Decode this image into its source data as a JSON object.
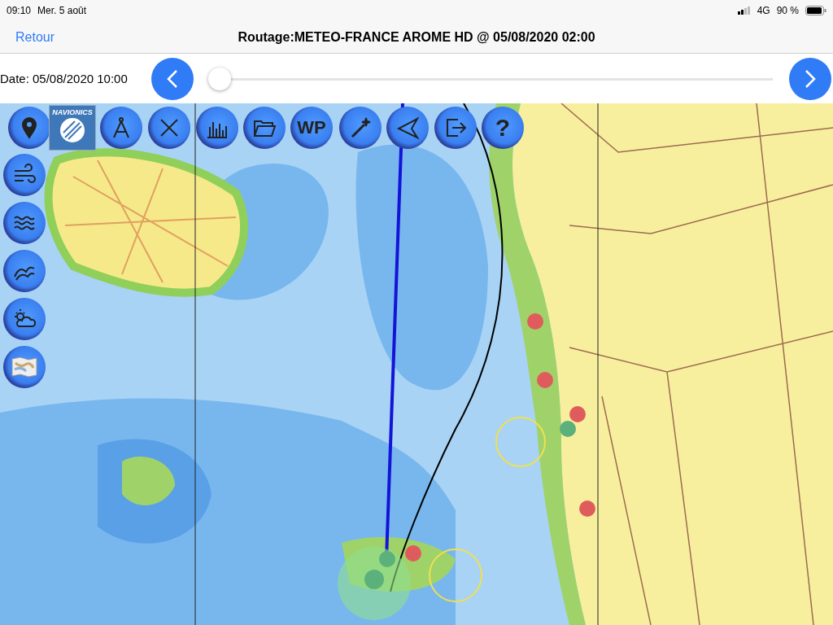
{
  "status_bar": {
    "time": "09:10",
    "date": "Mer. 5 août",
    "network": "4G",
    "battery": "90 %"
  },
  "nav_bar": {
    "back": "Retour",
    "title": "Routage:METEO-FRANCE AROME HD @ 05/08/2020 02:00"
  },
  "timeline": {
    "date": "Date: 05/08/2020 10:00",
    "level": 0
  },
  "toolbar": {
    "logo": "NAVIONICS",
    "waypoint": "WP",
    "help": "?"
  }
}
